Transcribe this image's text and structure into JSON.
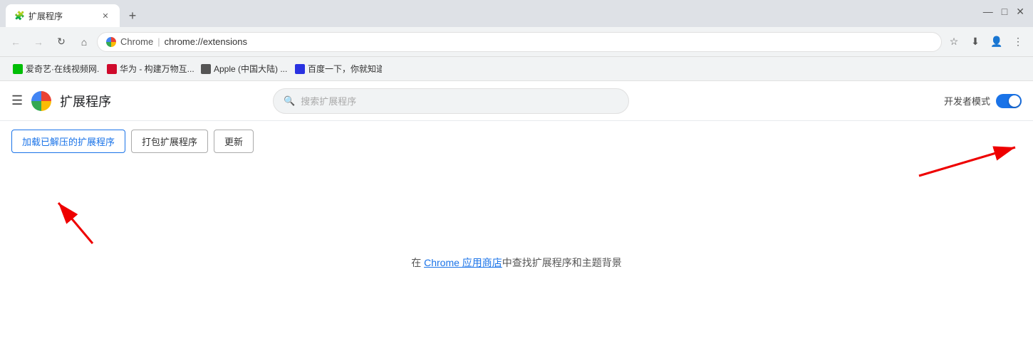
{
  "tab": {
    "title": "扩展程序",
    "favicon": "🔧"
  },
  "address": {
    "chrome_label": "Chrome",
    "separator": "|",
    "url": "chrome://extensions",
    "lock_icon": "🔒"
  },
  "bookmarks": [
    {
      "id": "bm1",
      "label": "爱奇艺·在线视频网...",
      "color": "#00be06"
    },
    {
      "id": "bm2",
      "label": "华为 - 构建万物互...",
      "color": "#cf0a2c"
    },
    {
      "id": "bm3",
      "label": "Apple (中国大陆) ...",
      "color": "#555"
    },
    {
      "id": "bm4",
      "label": "百度一下，你就知道",
      "color": "#2932e1"
    }
  ],
  "extensions_page": {
    "menu_icon": "☰",
    "title": "扩展程序",
    "search_placeholder": "搜索扩展程序",
    "dev_mode_label": "开发者模式",
    "toolbar": {
      "load_btn": "加载已解压的扩展程序",
      "pack_btn": "打包扩展程序",
      "update_btn": "更新"
    },
    "empty_state": {
      "prefix": "在",
      "link_text": "Chrome 应用商店",
      "suffix": "中查找扩展程序和主题背景"
    }
  },
  "browser_controls": {
    "back": "←",
    "forward": "→",
    "reload": "↻",
    "home": "⌂",
    "bookmark": "☆",
    "download": "⬇",
    "profile": "👤",
    "more": "⋮",
    "minimize": "—",
    "maximize": "□",
    "close": "✕",
    "new_tab": "+"
  }
}
